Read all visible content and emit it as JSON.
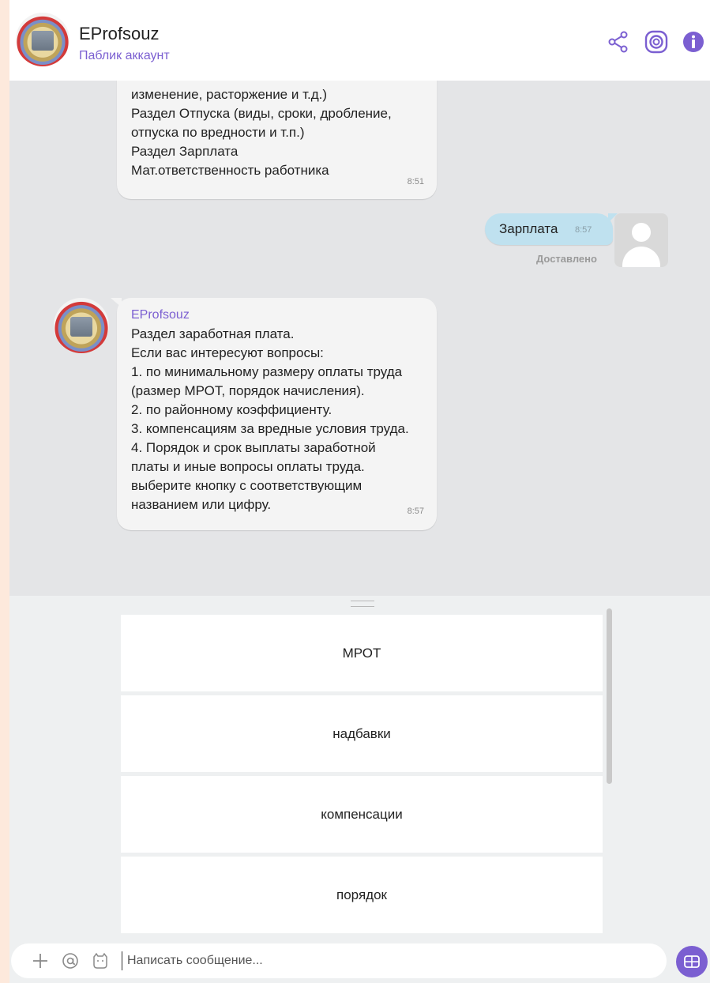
{
  "header": {
    "title": "EProfsouz",
    "subtitle": "Паблик аккаунт",
    "icons": [
      "share-icon",
      "rakuten-icon",
      "info-icon"
    ]
  },
  "messages": {
    "first": {
      "lines": [
        "изменение, расторжение и т.д.)",
        "Раздел Отпуска (виды, сроки, дробление,",
        "отпуска по вредности и т.п.)",
        "Раздел Зарплата",
        "Мат.ответственность работника"
      ],
      "time": "8:51"
    },
    "outgoing": {
      "text": "Зарплата",
      "time": "8:57",
      "status": "Доставлено"
    },
    "second": {
      "sender": "EProfsouz",
      "lines": [
        "Раздел заработная плата.",
        "Если вас интересуют вопросы:",
        "1. по минимальному размеру оплаты труда",
        "(размер МРОТ, порядок начисления).",
        "2. по районному коэффициенту.",
        "3. компенсациям за вредные условия труда.",
        "4. Порядок и срок выплаты заработной",
        "платы и иные вопросы оплаты труда.",
        "выберите кнопку с соответствующим",
        "названием или цифру."
      ],
      "time": "8:57"
    }
  },
  "keyboard": {
    "buttons": [
      "МРОТ",
      "надбавки",
      "компенсации",
      "порядок"
    ]
  },
  "input": {
    "placeholder": "Написать сообщение..."
  },
  "colors": {
    "accent": "#7b5fd1",
    "outgoing_bubble": "#bfe1ef",
    "incoming_bubble": "#f4f4f4",
    "chat_background": "#e4e5e7"
  }
}
